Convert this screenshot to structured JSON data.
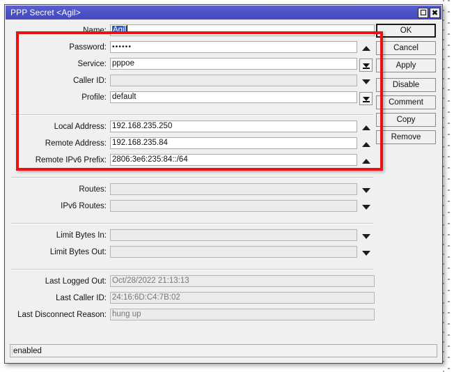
{
  "window": {
    "title": "PPP Secret <Agil>",
    "controls": [
      {
        "name": "maximize-button",
        "glyph": "square"
      },
      {
        "name": "close-button",
        "glyph": "x"
      }
    ]
  },
  "form": {
    "groups": [
      {
        "rows": [
          {
            "label": "Name:",
            "value": "Agil",
            "selected": true,
            "widget": "none",
            "disabled": false,
            "width": "full"
          },
          {
            "label": "Password:",
            "value": "••••••",
            "password": true,
            "widget": "up",
            "disabled": false,
            "width": "wide"
          },
          {
            "label": "Service:",
            "value": "pppoe",
            "widget": "dropdown",
            "disabled": false,
            "width": "wide"
          },
          {
            "label": "Caller ID:",
            "value": "",
            "widget": "down",
            "disabled": true,
            "width": "wide"
          },
          {
            "label": "Profile:",
            "value": "default",
            "widget": "dropdown",
            "disabled": false,
            "width": "wide"
          }
        ]
      },
      {
        "rows": [
          {
            "label": "Local Address:",
            "value": "192.168.235.250",
            "widget": "up",
            "disabled": false,
            "width": "wide"
          },
          {
            "label": "Remote Address:",
            "value": "192.168.235.84",
            "widget": "up",
            "disabled": false,
            "width": "wide"
          },
          {
            "label": "Remote IPv6 Prefix:",
            "value": "2806:3e6:235:84::/64",
            "widget": "up",
            "disabled": false,
            "width": "wide"
          }
        ]
      },
      {
        "rows": [
          {
            "label": "Routes:",
            "value": "",
            "widget": "down",
            "disabled": true,
            "width": "wide"
          },
          {
            "label": "IPv6 Routes:",
            "value": "",
            "widget": "down",
            "disabled": true,
            "width": "wide"
          }
        ]
      },
      {
        "rows": [
          {
            "label": "Limit Bytes In:",
            "value": "",
            "widget": "down",
            "disabled": true,
            "width": "wide"
          },
          {
            "label": "Limit Bytes Out:",
            "value": "",
            "widget": "down",
            "disabled": true,
            "width": "wide"
          }
        ]
      },
      {
        "rows": [
          {
            "label": "Last Logged Out:",
            "value": "Oct/28/2022 21:13:13",
            "widget": "none",
            "disabled": true,
            "width": "full"
          },
          {
            "label": "Last Caller ID:",
            "value": "24:16:6D:C4:7B:02",
            "widget": "none",
            "disabled": true,
            "width": "full"
          },
          {
            "label": "Last Disconnect Reason:",
            "value": "hung up",
            "widget": "none",
            "disabled": true,
            "width": "full"
          }
        ]
      }
    ]
  },
  "buttons": [
    {
      "label": "OK",
      "default": true,
      "spaced": false
    },
    {
      "label": "Cancel",
      "default": false,
      "spaced": false
    },
    {
      "label": "Apply",
      "default": false,
      "spaced": false
    },
    {
      "label": "Disable",
      "default": false,
      "spaced": true
    },
    {
      "label": "Comment",
      "default": false,
      "spaced": false
    },
    {
      "label": "Copy",
      "default": false,
      "spaced": false
    },
    {
      "label": "Remove",
      "default": false,
      "spaced": false
    }
  ],
  "status": {
    "text": "enabled"
  },
  "annotation": {
    "color": "#ee1111",
    "shape": "rectangle"
  }
}
